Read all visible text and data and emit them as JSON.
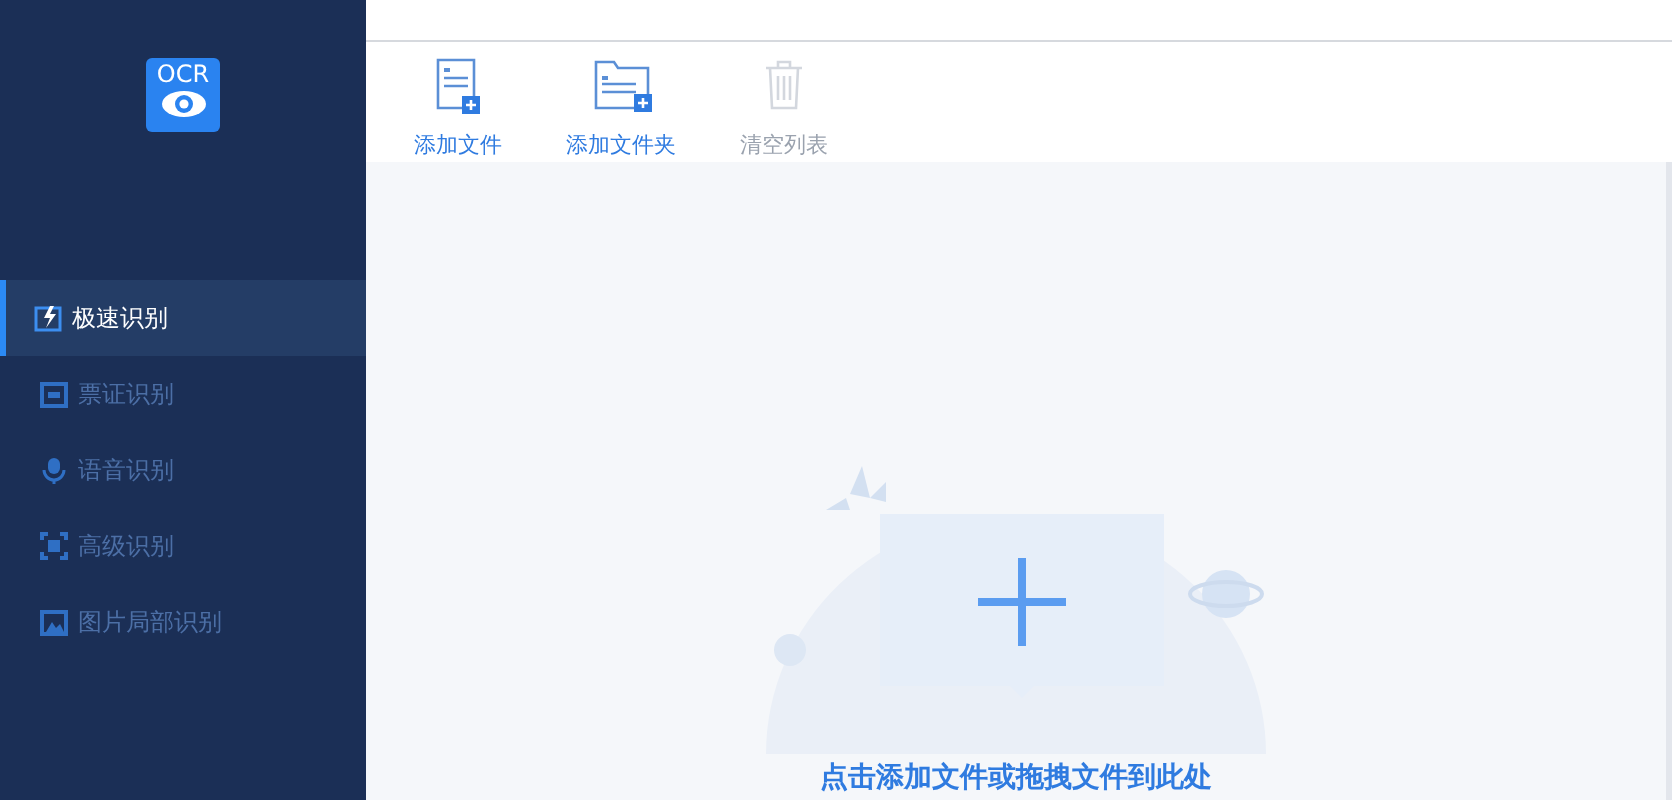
{
  "logo": {
    "text": "OCR"
  },
  "sidebar": {
    "items": [
      {
        "label": "极速识别",
        "selected": true,
        "kind": "bolt"
      },
      {
        "label": "票证识别",
        "selected": false,
        "kind": "ticket"
      },
      {
        "label": "语音识别",
        "selected": false,
        "kind": "mic"
      },
      {
        "label": "高级识别",
        "selected": false,
        "kind": "scan"
      },
      {
        "label": "图片局部识别",
        "selected": false,
        "kind": "image"
      }
    ]
  },
  "toolbar": [
    {
      "label": "添加文件",
      "disabled": false,
      "kind": "file"
    },
    {
      "label": "添加文件夹",
      "disabled": false,
      "kind": "folder"
    },
    {
      "label": "清空列表",
      "disabled": true,
      "kind": "trash"
    }
  ],
  "drop_zone": {
    "hint": "点击添加文件或拖拽文件到此处"
  }
}
